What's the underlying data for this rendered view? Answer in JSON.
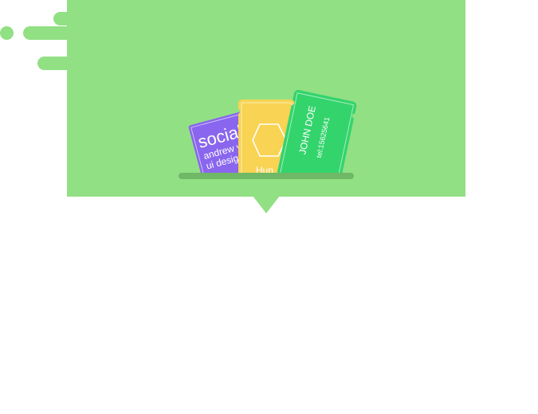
{
  "cards": {
    "purple": {
      "title": "social",
      "name": "andrew y",
      "role": "ui design",
      "color": "#8a66ee"
    },
    "yellow": {
      "text": "Hun",
      "color": "#f8d354"
    },
    "green": {
      "name": "JOHN DOE",
      "phone": "tel:15625641",
      "color": "#34d46c"
    }
  },
  "colors": {
    "banner": "#92e084",
    "shelf": "#6fb865"
  }
}
